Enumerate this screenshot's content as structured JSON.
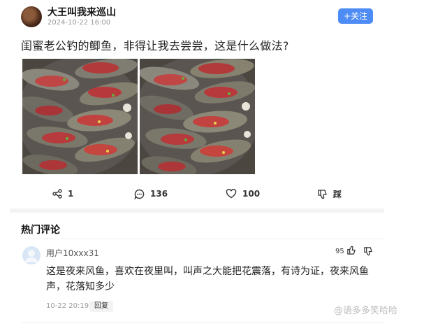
{
  "post": {
    "username": "大王叫我来巡山",
    "time": "2024-10-22 16:00",
    "follow_label": "+关注",
    "text": "闺蜜老公钓的鲫鱼，非得让我去尝尝，这是什么做法?",
    "photos": [
      "fish-dish-photo-1",
      "fish-dish-photo-2"
    ]
  },
  "actions": {
    "share_count": "1",
    "comment_count": "136",
    "like_count": "100",
    "dislike_label": "踩"
  },
  "comments": {
    "section_title": "热门评论",
    "items": [
      {
        "user": "用户10xxx31",
        "likes": "95",
        "text": "这是夜来风鱼，喜欢在夜里叫，叫声之大能把花震落，有诗为证，夜来风鱼声，花落知多少",
        "time": "10-22 20:19",
        "reply_label": "回复"
      }
    ]
  },
  "watermark": "@语多多笑哈哈",
  "colors": {
    "accent": "#4e8cf5"
  }
}
